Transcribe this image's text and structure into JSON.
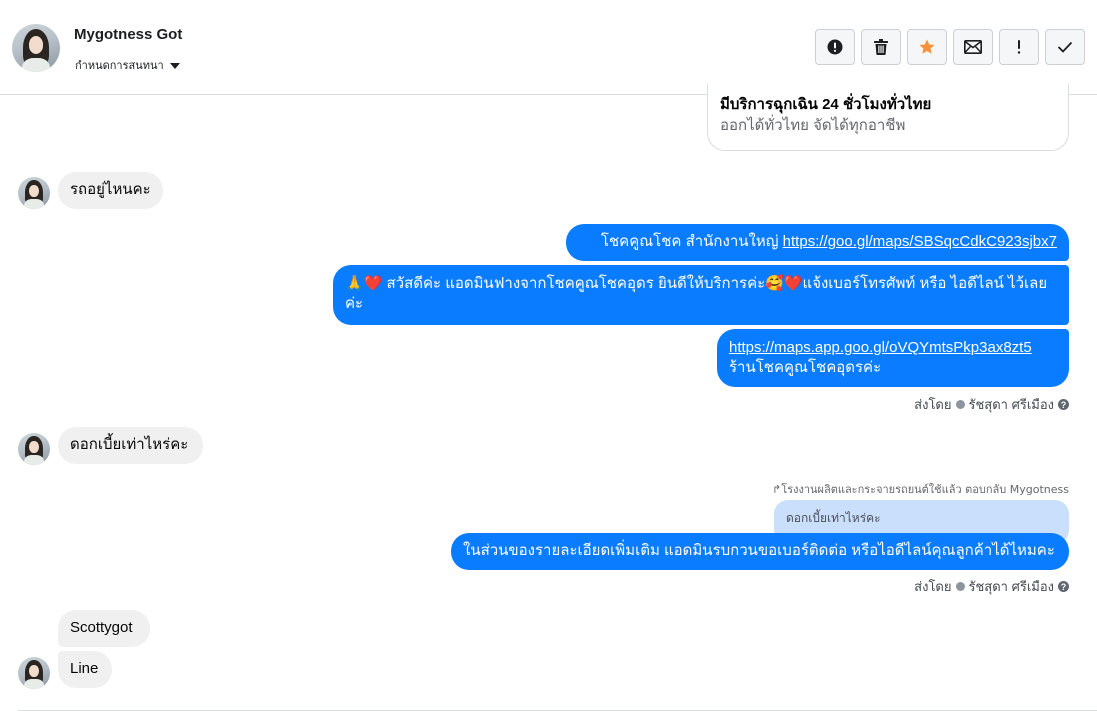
{
  "header": {
    "name": "Mygotness Got",
    "assign_label": "กำหนดการสนทนา",
    "toolbar": [
      {
        "name": "alert-button",
        "icon": "exclamation-circle-icon"
      },
      {
        "name": "delete-button",
        "icon": "trash-icon"
      },
      {
        "name": "star-button",
        "icon": "star-icon"
      },
      {
        "name": "mark-unread-button",
        "icon": "envelope-icon"
      },
      {
        "name": "spam-button",
        "icon": "exclamation-icon"
      },
      {
        "name": "done-button",
        "icon": "check-icon"
      }
    ]
  },
  "card": {
    "title": "มีบริการฉุกเฉิน 24 ชั่วโมงทั่วไทย",
    "subtitle": "ออกได้ทั่วไทย จัดได้ทุกอาชีพ"
  },
  "messages": {
    "in1": "รถอยู่ไหนคะ",
    "out1_prefix": "โชคคูณโชค สำนักงานใหญ่ ",
    "out1_link": "https://goo.gl/maps/SBSqcCdkC923sjbx7",
    "out2_line1": "🙏❤️ สวัสดีค่ะ แอดมินฟางจากโชคคูณโชคอุดร ยินดีให้บริการค่ะ🥰❤️แจ้งเบอร์โทรศัพท์ หรือ ไอดีไลน์  ไว้เลย",
    "out2_line2": "ค่ะ",
    "out3_link": "https://maps.app.goo.gl/oVQYmtsPkp3ax8zt5",
    "out3_line2": "ร้านโชคคูณโชคอุดรค่ะ",
    "sent_by_1": "ส่งโดย",
    "agent_1": "รัชสุดา ศรีเมือง",
    "in2": "ดอกเบี้ยเท่าไหร่คะ",
    "reply_note": "↱โรงงานผลิตและกระจายรถยนต์ใช้แล้ว ตอบกลับ Mygotness",
    "quoted": "ดอกเบี้ยเท่าไหร่คะ",
    "out4": "ในส่วนของรายละเอียดเพิ่มเติม แอดมินรบกวนขอเบอร์ติดต่อ หรือไอดีไลน์คุณลูกค้าได้ไหมคะ",
    "sent_by_2": "ส่งโดย",
    "agent_2": "รัชสุดา ศรีเมือง",
    "in3": "Scottygot",
    "in4": "Line"
  },
  "colors": {
    "outgoing": "#0a7cff",
    "incoming": "#f0f0f0",
    "quoted": "#c9dffc",
    "star": "#f7923b"
  }
}
